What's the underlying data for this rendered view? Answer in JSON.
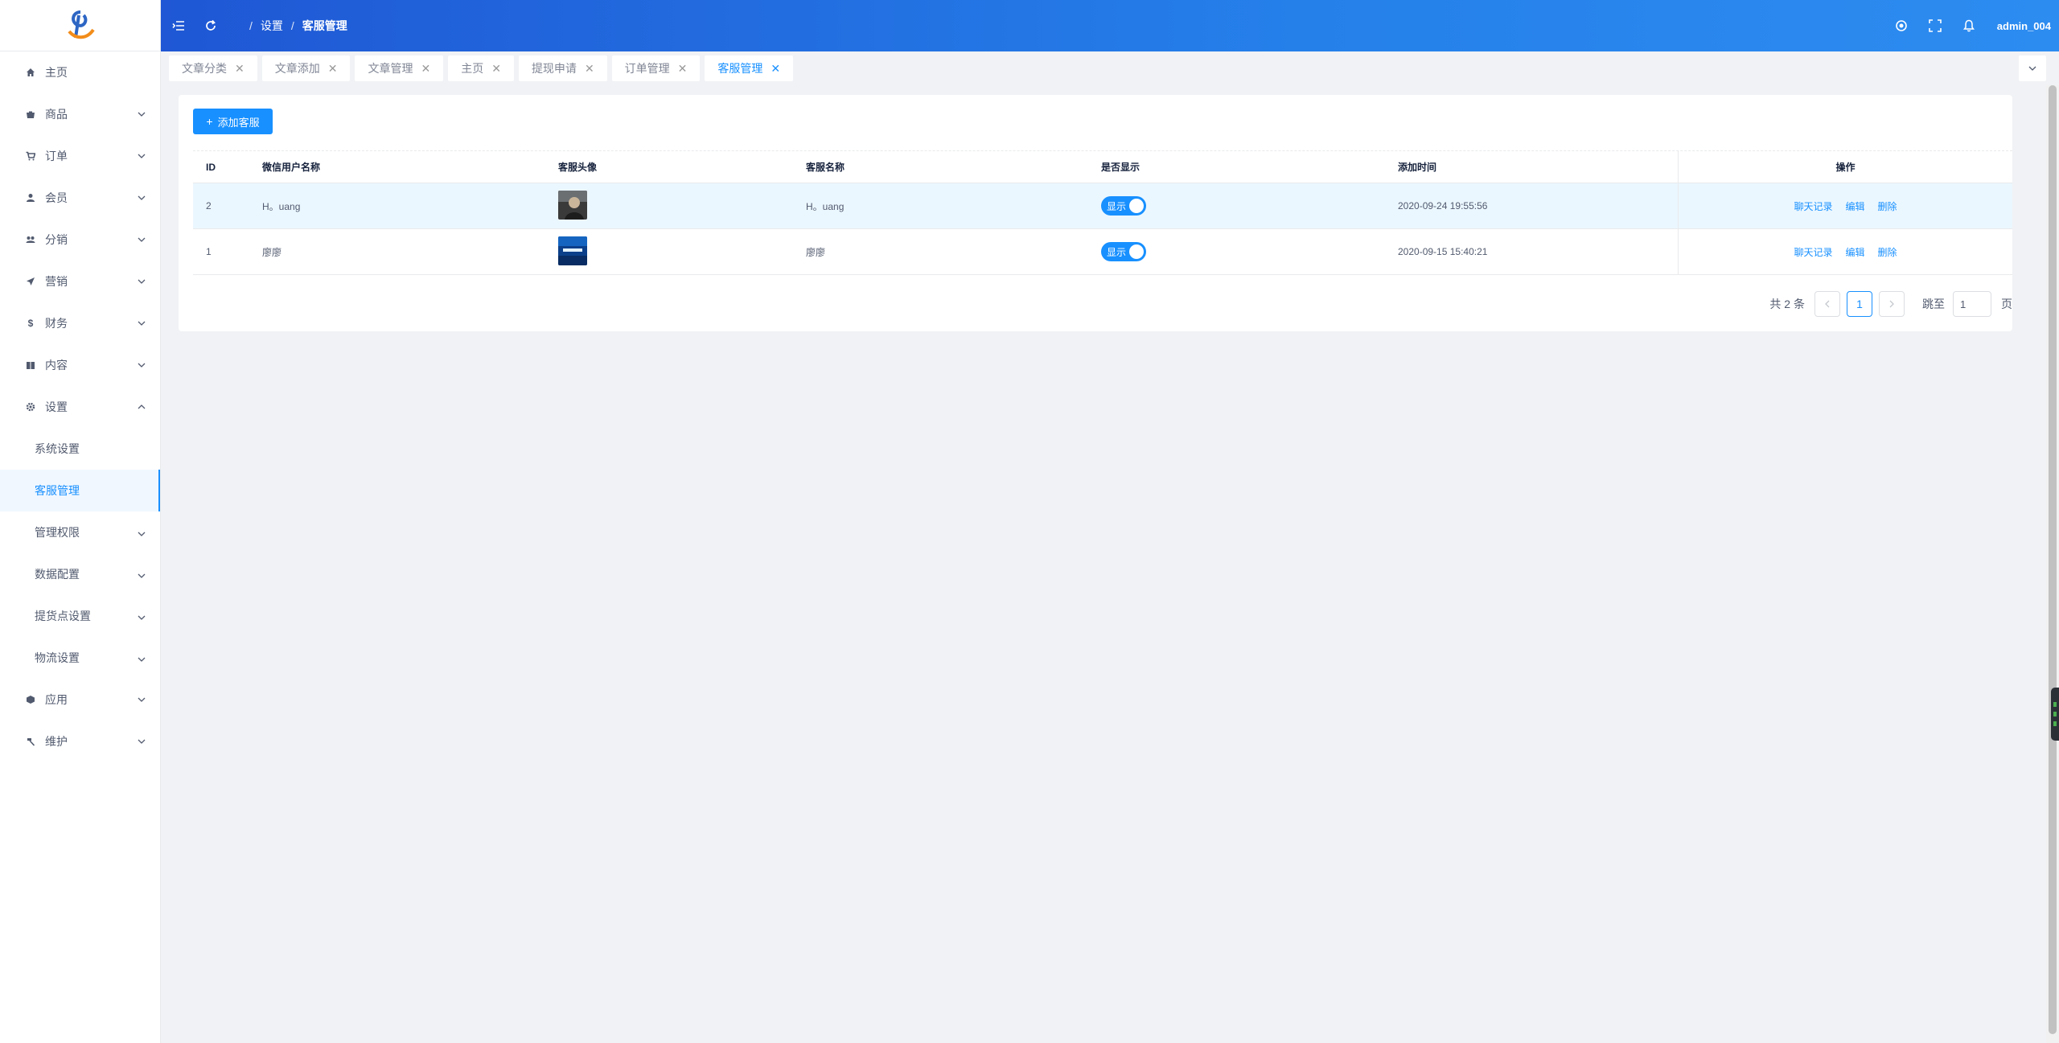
{
  "header": {
    "breadcrumb": [
      "设置",
      "客服管理"
    ],
    "user": "admin_004"
  },
  "sidebar": {
    "items": [
      {
        "label": "主页",
        "icon": "home-icon"
      },
      {
        "label": "商品",
        "icon": "goods-icon"
      },
      {
        "label": "订单",
        "icon": "cart-icon"
      },
      {
        "label": "会员",
        "icon": "user-icon"
      },
      {
        "label": "分销",
        "icon": "distribution-icon"
      },
      {
        "label": "营销",
        "icon": "send-icon"
      },
      {
        "label": "财务",
        "icon": "dollar-icon"
      },
      {
        "label": "内容",
        "icon": "book-icon"
      },
      {
        "label": "设置",
        "icon": "gear-icon"
      },
      {
        "label": "应用",
        "icon": "cube-icon"
      },
      {
        "label": "维护",
        "icon": "hammer-icon"
      }
    ],
    "settings_children": [
      "系统设置",
      "客服管理",
      "管理权限",
      "数据配置",
      "提货点设置",
      "物流设置"
    ]
  },
  "tabs": [
    "文章分类",
    "文章添加",
    "文章管理",
    "主页",
    "提现申请",
    "订单管理",
    "客服管理"
  ],
  "toolbar": {
    "add_label": "添加客服"
  },
  "table": {
    "columns": [
      "ID",
      "微信用户名称",
      "客服头像",
      "客服名称",
      "是否显示",
      "添加时间",
      "操作"
    ],
    "rows": [
      {
        "id": "2",
        "wx_name": "H。uang",
        "name": "H。uang",
        "show": "显示",
        "time": "2020-09-24 19:55:56",
        "avatar": "dark-portrait"
      },
      {
        "id": "1",
        "wx_name": "廖廖",
        "name": "廖廖",
        "show": "显示",
        "time": "2020-09-15 15:40:21",
        "avatar": "blue-banner"
      }
    ],
    "actions": [
      "聊天记录",
      "编辑",
      "删除"
    ]
  },
  "pagination": {
    "total": "共 2 条",
    "current": "1",
    "jump_label": "跳至",
    "jump_value": "1",
    "unit": "页"
  },
  "colors": {
    "primary": "#1890ff",
    "header_start": "#1f57d4",
    "header_end": "#2d8cf0"
  }
}
